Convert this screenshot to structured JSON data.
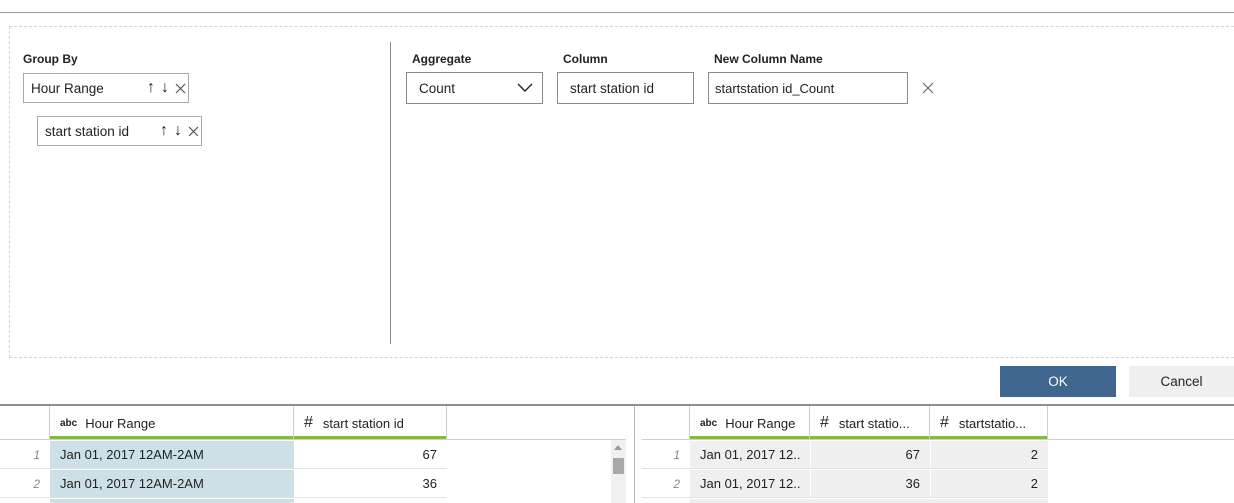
{
  "group_by": {
    "label": "Group By",
    "chips": [
      {
        "label": "Hour Range"
      },
      {
        "label": "start station id"
      }
    ]
  },
  "aggregate": {
    "label": "Aggregate",
    "value": "Count"
  },
  "column": {
    "label": "Column",
    "value": "start station id"
  },
  "new_column": {
    "label": "New Column Name",
    "value": "startstation id_Count"
  },
  "buttons": {
    "ok": "OK",
    "cancel": "Cancel"
  },
  "input_grid": {
    "columns": [
      {
        "type": "abc",
        "label": "Hour Range"
      },
      {
        "type": "#",
        "label": "start station id"
      }
    ],
    "rows": [
      {
        "n": "1",
        "hour": "Jan 01, 2017 12AM-2AM",
        "station": "67"
      },
      {
        "n": "2",
        "hour": "Jan 01, 2017 12AM-2AM",
        "station": "36"
      }
    ]
  },
  "output_grid": {
    "columns": [
      {
        "type": "abc",
        "label": "Hour Range"
      },
      {
        "type": "#",
        "label": "start statio..."
      },
      {
        "type": "#",
        "label": "startstatio..."
      }
    ],
    "rows": [
      {
        "n": "1",
        "hour": "Jan 01, 2017 12..",
        "station": "67",
        "count": "2"
      },
      {
        "n": "2",
        "hour": "Jan 01, 2017 12..",
        "station": "36",
        "count": "2"
      }
    ]
  },
  "colors": {
    "accent": "#3f668f",
    "column_quality_bar": "#7dc12f",
    "selected_column": "#cde0e7"
  }
}
